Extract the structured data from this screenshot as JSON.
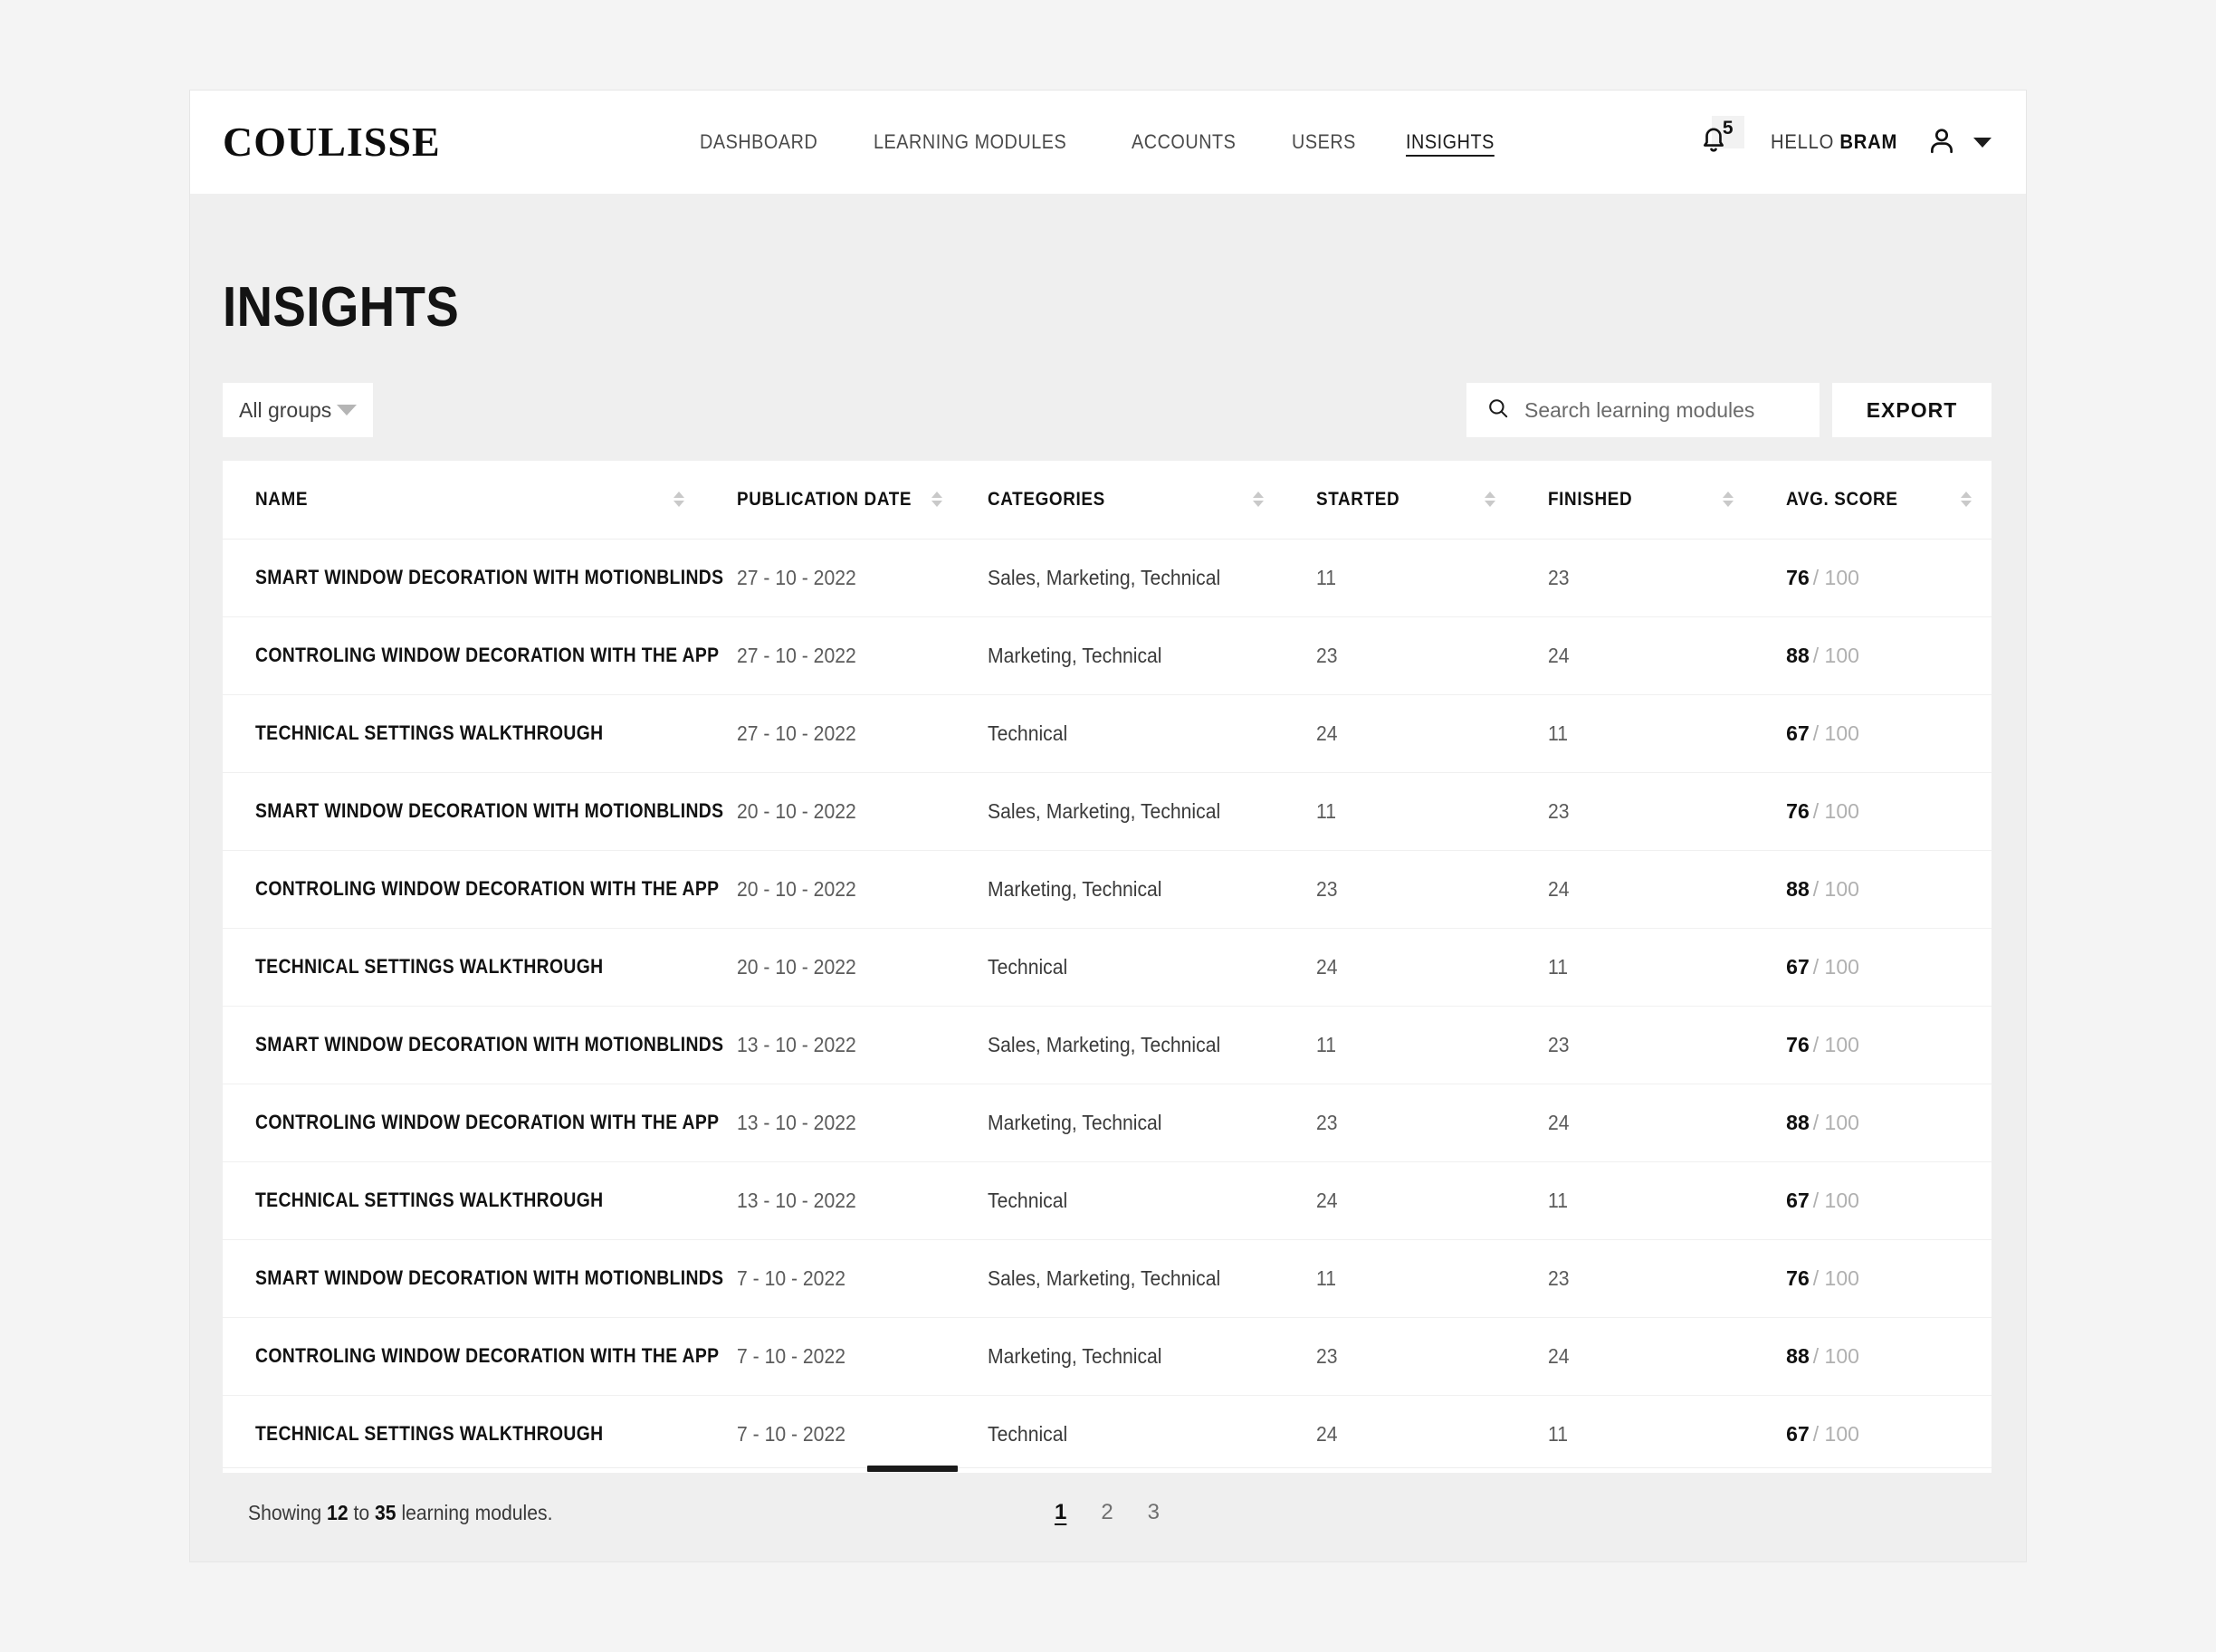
{
  "header": {
    "brand": "COULISSE",
    "nav": [
      {
        "label": "DASHBOARD",
        "active": false
      },
      {
        "label": "LEARNING MODULES",
        "active": false
      },
      {
        "label": "ACCOUNTS",
        "active": false
      },
      {
        "label": "USERS",
        "active": false
      },
      {
        "label": "INSIGHTS",
        "active": true
      }
    ],
    "notifications": {
      "icon": "bell-icon",
      "count": "5"
    },
    "greeting_prefix": "HELLO ",
    "user_name": "BRAM",
    "avatar_icon": "user-icon",
    "caret_icon": "chevron-down-icon"
  },
  "page": {
    "title": "INSIGHTS"
  },
  "toolbar": {
    "group_filter": {
      "selected": "All groups",
      "caret_icon": "chevron-down-icon"
    },
    "search": {
      "icon": "search-icon",
      "placeholder": "Search learning modules",
      "value": ""
    },
    "export_label": "EXPORT"
  },
  "table": {
    "columns": [
      {
        "label": "NAME",
        "sortable": true
      },
      {
        "label": "PUBLICATION DATE",
        "sortable": true
      },
      {
        "label": "CATEGORIES",
        "sortable": true
      },
      {
        "label": "STARTED",
        "sortable": true
      },
      {
        "label": "FINISHED",
        "sortable": true
      },
      {
        "label": "AVG. SCORE",
        "sortable": true
      }
    ],
    "score_max_label": "/ 100",
    "rows": [
      {
        "name": "SMART WINDOW DECORATION WITH MOTIONBLINDS",
        "date": "27 - 10 - 2022",
        "categories": "Sales, Marketing, Technical",
        "started": "11",
        "finished": "23",
        "score": "76",
        "score_max": "/ 100"
      },
      {
        "name": "CONTROLING WINDOW DECORATION WITH THE APP",
        "date": "27 - 10 - 2022",
        "categories": "Marketing, Technical",
        "started": "23",
        "finished": "24",
        "score": "88",
        "score_max": "/ 100"
      },
      {
        "name": "TECHNICAL SETTINGS WALKTHROUGH",
        "date": "27 - 10 - 2022",
        "categories": "Technical",
        "started": "24",
        "finished": "11",
        "score": "67",
        "score_max": "/ 100"
      },
      {
        "name": "SMART WINDOW DECORATION WITH MOTIONBLINDS",
        "date": "20 - 10 - 2022",
        "categories": "Sales, Marketing, Technical",
        "started": "11",
        "finished": "23",
        "score": "76",
        "score_max": "/ 100"
      },
      {
        "name": "CONTROLING WINDOW DECORATION WITH THE APP",
        "date": "20 - 10 - 2022",
        "categories": "Marketing, Technical",
        "started": "23",
        "finished": "24",
        "score": "88",
        "score_max": "/ 100"
      },
      {
        "name": "TECHNICAL SETTINGS WALKTHROUGH",
        "date": "20 - 10 - 2022",
        "categories": "Technical",
        "started": "24",
        "finished": "11",
        "score": "67",
        "score_max": "/ 100"
      },
      {
        "name": "SMART WINDOW DECORATION WITH MOTIONBLINDS",
        "date": "13 - 10 - 2022",
        "categories": "Sales, Marketing, Technical",
        "started": "11",
        "finished": "23",
        "score": "76",
        "score_max": "/ 100"
      },
      {
        "name": "CONTROLING WINDOW DECORATION WITH THE APP",
        "date": "13 - 10 - 2022",
        "categories": "Marketing, Technical",
        "started": "23",
        "finished": "24",
        "score": "88",
        "score_max": "/ 100"
      },
      {
        "name": "TECHNICAL SETTINGS WALKTHROUGH",
        "date": "13 - 10 - 2022",
        "categories": "Technical",
        "started": "24",
        "finished": "11",
        "score": "67",
        "score_max": "/ 100"
      },
      {
        "name": "SMART WINDOW DECORATION WITH MOTIONBLINDS",
        "date": "7 - 10 - 2022",
        "categories": "Sales, Marketing, Technical",
        "started": "11",
        "finished": "23",
        "score": "76",
        "score_max": "/ 100"
      },
      {
        "name": "CONTROLING WINDOW DECORATION WITH THE APP",
        "date": "7 - 10 - 2022",
        "categories": "Marketing, Technical",
        "started": "23",
        "finished": "24",
        "score": "88",
        "score_max": "/ 100"
      },
      {
        "name": "TECHNICAL SETTINGS WALKTHROUGH",
        "date": "7 - 10 - 2022",
        "categories": "Technical",
        "started": "24",
        "finished": "11",
        "score": "67",
        "score_max": "/ 100"
      }
    ]
  },
  "footer": {
    "showing_prefix": "Showing ",
    "showing_from": "12",
    "showing_middle": " to ",
    "showing_to": "35",
    "showing_suffix": " learning modules.",
    "pages": [
      {
        "label": "1",
        "current": true
      },
      {
        "label": "2",
        "current": false
      },
      {
        "label": "3",
        "current": false
      }
    ]
  },
  "colors": {
    "page_background": "#f4f4f4",
    "content_background": "#efefef",
    "surface": "#ffffff",
    "text_primary": "#111111",
    "text_muted": "#5b5b5b",
    "divider": "#f0f0f0",
    "scrollbar_thumb": "#1a1a1a"
  }
}
